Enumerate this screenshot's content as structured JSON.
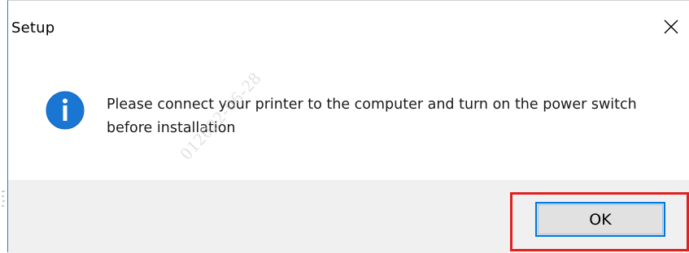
{
  "window": {
    "title": "Setup",
    "close_icon": "close-icon"
  },
  "message": {
    "icon": "info-icon",
    "text": "Please connect your printer to the computer and turn on the power switch before installation"
  },
  "footer": {
    "ok_label": "OK",
    "highlight_color": "#e02020"
  },
  "watermark": {
    "text": "012022-06-28"
  },
  "colors": {
    "accent": "#0078d7",
    "info_icon": "#1976d2",
    "footer_bg": "#f0f0f0"
  }
}
